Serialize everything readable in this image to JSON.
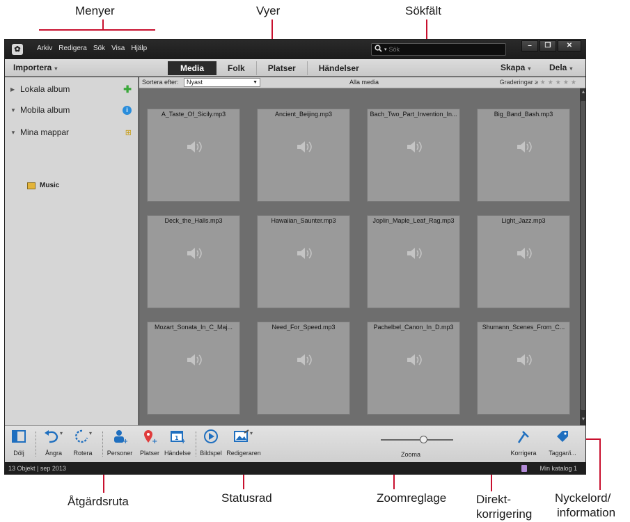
{
  "callouts": {
    "menus": "Menyer",
    "views": "Vyer",
    "search_field": "Sökfält",
    "action_pane": "Åtgärdsruta",
    "status_bar": "Statusrad",
    "zoom_slider": "Zoomreglage",
    "quick_fix_1": "Direkt-",
    "quick_fix_2": "korrigering",
    "keywords_1": "Nyckelord/",
    "keywords_2": "information"
  },
  "menubar": [
    "Arkiv",
    "Redigera",
    "Sök",
    "Visa",
    "Hjälp"
  ],
  "search": {
    "placeholder": "Sök"
  },
  "window_buttons": {
    "minimize": "–",
    "restore": "❐",
    "close": "✕"
  },
  "viewbar": {
    "import": "Importera",
    "tabs": [
      "Media",
      "Folk",
      "Platser",
      "Händelser"
    ],
    "active_tab": "Media",
    "create": "Skapa",
    "share": "Dela"
  },
  "sidebar": {
    "local_albums": "Lokala album",
    "mobile_albums": "Mobila album",
    "my_folders": "Mina mappar",
    "folders": [
      "Music"
    ]
  },
  "sortbar": {
    "sort_label": "Sortera efter:",
    "sort_value": "Nyast",
    "all_media": "Alla media",
    "ratings_label": "Graderingar  ≥",
    "stars": "★★★★★"
  },
  "media_files": [
    "A_Taste_Of_Sicily.mp3",
    "Ancient_Beijing.mp3",
    "Bach_Two_Part_Invention_In...",
    "Big_Band_Bash.mp3",
    "Deck_the_Halls.mp3",
    "Hawaiian_Saunter.mp3",
    "Joplin_Maple_Leaf_Rag.mp3",
    "Light_Jazz.mp3",
    "Mozart_Sonata_In_C_Maj...",
    "Need_For_Speed.mp3",
    "Pachelbel_Canon_In_D.mp3",
    "Shumann_Scenes_From_C..."
  ],
  "actions": {
    "hide": "Dölj",
    "undo": "Ångra",
    "rotate": "Rotera",
    "people": "Personer",
    "places": "Platser",
    "event": "Händelse",
    "slideshow": "Bildspel",
    "editor": "Redigeraren",
    "zoom": "Zooma",
    "fix": "Korrigera",
    "tags": "Taggar/i..."
  },
  "statusbar": {
    "items": "13 Objekt",
    "date": "sep 2013",
    "catalog": "Min katalog 1"
  },
  "colors": {
    "annotation_line": "#c8102e",
    "active_tab_bg": "#2b2b2b",
    "media_bg": "#6e6e6e"
  }
}
